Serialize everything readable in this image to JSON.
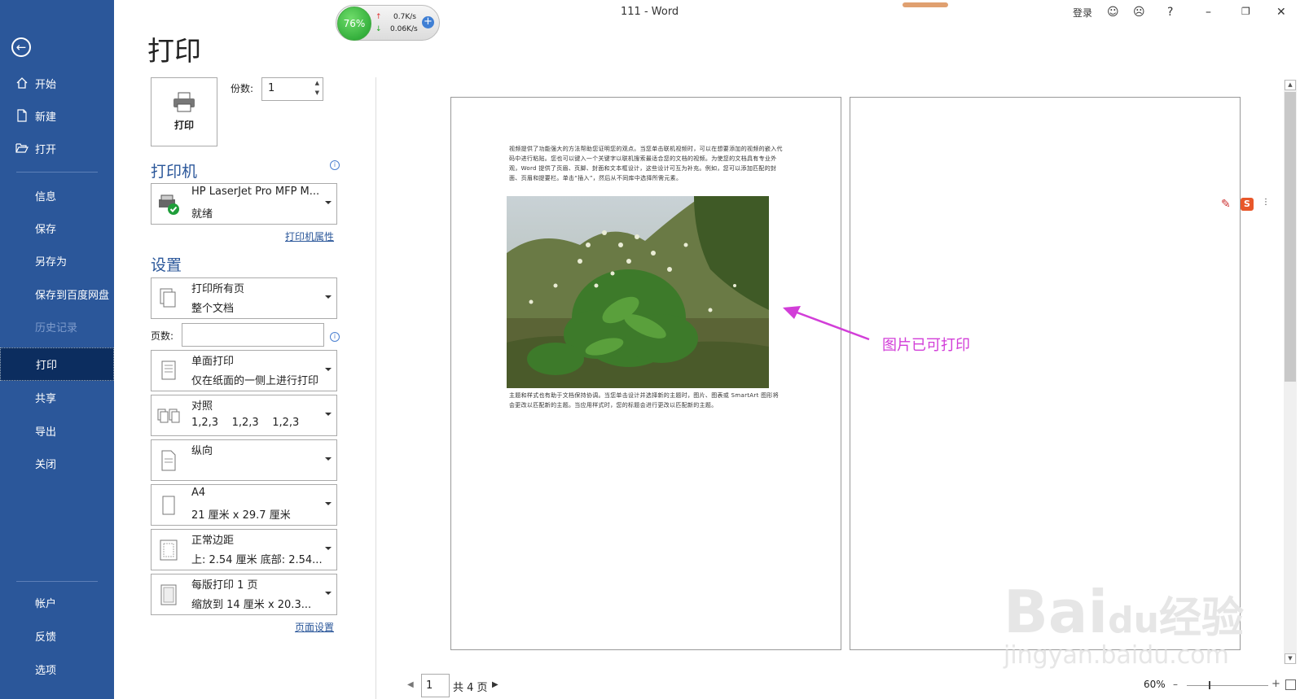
{
  "window": {
    "title": "111  -  Word",
    "login": "登录"
  },
  "network_widget": {
    "percent": "76%",
    "up": "0.7K/s",
    "down": "0.06K/s"
  },
  "sidebar": {
    "items": [
      {
        "label": "开始"
      },
      {
        "label": "新建"
      },
      {
        "label": "打开"
      },
      {
        "label": "信息"
      },
      {
        "label": "保存"
      },
      {
        "label": "另存为"
      },
      {
        "label": "保存到百度网盘"
      },
      {
        "label": "历史记录"
      },
      {
        "label": "打印"
      },
      {
        "label": "共享"
      },
      {
        "label": "导出"
      },
      {
        "label": "关闭"
      },
      {
        "label": "帐户"
      },
      {
        "label": "反馈"
      },
      {
        "label": "选项"
      }
    ]
  },
  "print": {
    "title": "打印",
    "print_button": "打印",
    "copies_label": "份数:",
    "copies_value": "1",
    "printer_heading": "打印机",
    "printer_name": "HP LaserJet Pro MFP M...",
    "printer_status": "就绪",
    "printer_props": "打印机属性",
    "settings_heading": "设置",
    "pages_label": "页数:",
    "pages_value": "",
    "page_setup": "页面设置",
    "settings": [
      {
        "line1": "打印所有页",
        "line2": "整个文档"
      },
      {
        "line1": "单面打印",
        "line2": "仅在纸面的一侧上进行打印"
      },
      {
        "line1": "对照",
        "line2": "1,2,3    1,2,3    1,2,3"
      },
      {
        "line1": "纵向",
        "line2": ""
      },
      {
        "line1": "A4",
        "line2": "21 厘米 x 29.7 厘米"
      },
      {
        "line1": "正常边距",
        "line2": "上: 2.54 厘米 底部: 2.54..."
      },
      {
        "line1": "每版打印 1 页",
        "line2": "缩放到 14 厘米 x 20.3..."
      }
    ]
  },
  "preview": {
    "para1": "视频提供了功能强大的方法帮助您证明您的观点。当您单击联机视频时，可以在想要添加的视频的嵌入代码中进行粘贴。您也可以键入一个关键字以联机搜索最适合您的文档的视频。为使您的文档具有专业外观，Word 提供了页眉、页脚、封面和文本框设计，这些设计可互为补充。例如，您可以添加匹配的封面、页眉和提要栏。单击“插入”，然后从不同库中选择所需元素。",
    "para2": "主题和样式也有助于文档保持协调。当您单击设计并选择新的主题时，图片、图表或 SmartArt 图形将会更改以匹配新的主题。当应用样式时，您的标题会进行更改以匹配新的主题。",
    "annotation": "图片已可打印",
    "page_current": "1",
    "page_total": "共 4 页",
    "zoom": "60%"
  },
  "watermark": {
    "brand": "Bai",
    "brand2": "du",
    "brand3": "经验",
    "url": "jingyan.baidu.com"
  }
}
